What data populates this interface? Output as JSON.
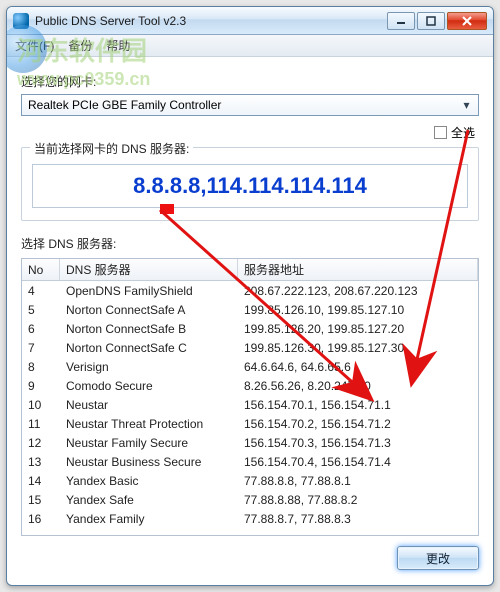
{
  "window": {
    "title": "Public DNS Server Tool v2.3"
  },
  "menu": {
    "file": "文件(F)",
    "backup": "备份",
    "help": "帮助"
  },
  "watermark": {
    "cn": "河东软件园",
    "url": "www.pc0359.cn"
  },
  "nic": {
    "label": "选择您的网卡:",
    "value": "Realtek PCIe GBE Family Controller"
  },
  "select_all": {
    "label": "全选",
    "checked": false
  },
  "current": {
    "group_title": "当前选择网卡的 DNS 服务器:",
    "value": "8.8.8.8,114.114.114.114"
  },
  "servers": {
    "label": "选择 DNS 服务器:",
    "columns": {
      "no": "No",
      "name": "DNS 服务器",
      "addr": "服务器地址"
    },
    "rows": [
      {
        "no": "4",
        "name": "OpenDNS FamilyShield",
        "addr": "208.67.222.123, 208.67.220.123"
      },
      {
        "no": "5",
        "name": "Norton ConnectSafe A",
        "addr": "199.85.126.10, 199.85.127.10"
      },
      {
        "no": "6",
        "name": "Norton ConnectSafe B",
        "addr": "199.85.126.20, 199.85.127.20"
      },
      {
        "no": "7",
        "name": "Norton ConnectSafe C",
        "addr": "199.85.126.30, 199.85.127.30"
      },
      {
        "no": "8",
        "name": "Verisign",
        "addr": "64.6.64.6, 64.6.65.6"
      },
      {
        "no": "9",
        "name": "Comodo Secure",
        "addr": "8.26.56.26, 8.20.247.20"
      },
      {
        "no": "10",
        "name": "Neustar",
        "addr": "156.154.70.1, 156.154.71.1"
      },
      {
        "no": "11",
        "name": "Neustar Threat Protection",
        "addr": "156.154.70.2, 156.154.71.2"
      },
      {
        "no": "12",
        "name": "Neustar Family Secure",
        "addr": "156.154.70.3, 156.154.71.3"
      },
      {
        "no": "13",
        "name": "Neustar Business Secure",
        "addr": "156.154.70.4, 156.154.71.4"
      },
      {
        "no": "14",
        "name": "Yandex Basic",
        "addr": "77.88.8.8, 77.88.8.1"
      },
      {
        "no": "15",
        "name": "Yandex Safe",
        "addr": "77.88.8.88, 77.88.8.2"
      },
      {
        "no": "16",
        "name": "Yandex Family",
        "addr": "77.88.8.7, 77.88.8.3"
      }
    ]
  },
  "buttons": {
    "change": "更改"
  },
  "annotation": {
    "arrows_color": "#e11212"
  }
}
